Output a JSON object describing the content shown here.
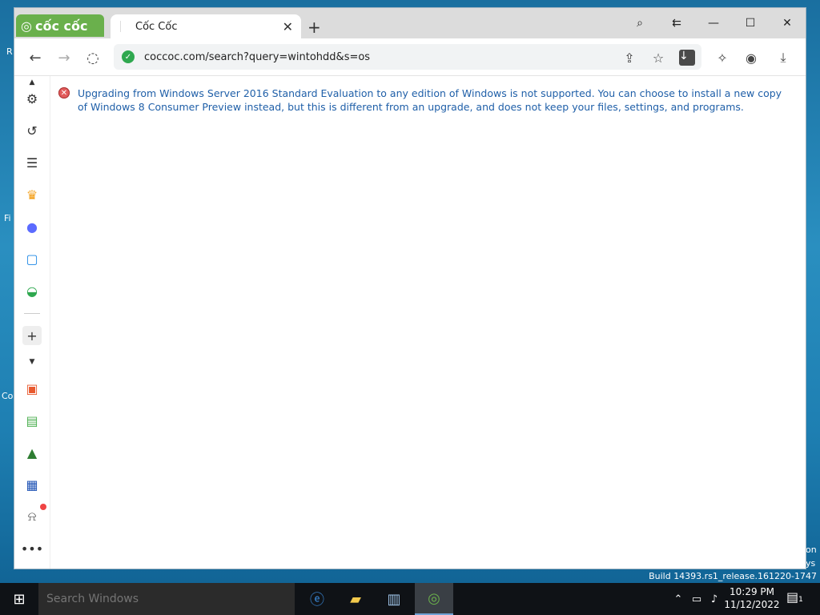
{
  "browser": {
    "brand": "cốc cốc",
    "tab": {
      "title": "Cốc Cốc"
    },
    "address": {
      "url": "coccoc.com/search?query=wintohdd&s=os"
    }
  },
  "content": {
    "error_message": "Upgrading from Windows Server 2016 Standard Evaluation to any edition of Windows is not supported. You can choose to install a new copy of Windows 8 Consumer Preview instead, but this is different from an upgrade, and does not keep your files, settings, and programs."
  },
  "desktop": {
    "build": "Build 14393.rs1_release.161220-1747"
  },
  "taskbar": {
    "search_placeholder": "Search Windows",
    "time": "10:29 PM",
    "date": "11/12/2022",
    "notification_count": "1"
  },
  "colors": {
    "brand_green": "#6ab04c",
    "error_red": "#e25b5b",
    "link_blue": "#1f5fa8"
  }
}
